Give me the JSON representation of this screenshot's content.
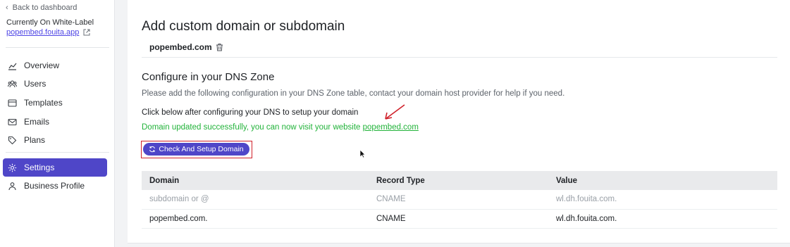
{
  "sidebar": {
    "back_label": "Back to dashboard",
    "current_label": "Currently On White-Label",
    "current_domain": "popembed.fouita.app",
    "items": [
      {
        "label": "Overview",
        "icon": "chart-icon"
      },
      {
        "label": "Users",
        "icon": "users-icon"
      },
      {
        "label": "Templates",
        "icon": "template-icon"
      },
      {
        "label": "Emails",
        "icon": "mail-icon"
      },
      {
        "label": "Plans",
        "icon": "tag-icon"
      },
      {
        "label": "Settings",
        "icon": "gear-icon",
        "active": true
      },
      {
        "label": "Business Profile",
        "icon": "user-icon"
      }
    ]
  },
  "main": {
    "title": "Add custom domain or subdomain",
    "domain": "popembed.com",
    "dns_title": "Configure in your DNS Zone",
    "dns_description": "Please add the following configuration in your DNS Zone table, contact your domain host provider for help if you need.",
    "instruction": "Click below after configuring your DNS to setup your domain",
    "success_prefix": "Domain updated successfully, you can now visit your website ",
    "success_link": "popembed.com",
    "button_label": "Check And Setup Domain",
    "table": {
      "headers": [
        "Domain",
        "Record Type",
        "Value"
      ],
      "rows": [
        [
          "subdomain or @",
          "CNAME",
          "wl.dh.fouita.com."
        ],
        [
          "popembed.com.",
          "CNAME",
          "wl.dh.fouita.com."
        ]
      ]
    }
  },
  "colors": {
    "accent": "#4f46c8",
    "success": "#22b33a",
    "annotation": "#d0202a"
  }
}
